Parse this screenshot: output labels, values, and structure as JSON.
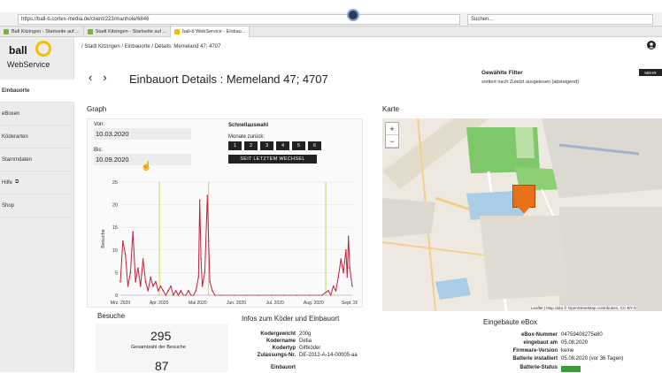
{
  "browser": {
    "url": "https://ball-b.cortex-media.de/client/223/manhole/6846",
    "search_placeholder": "Suchen...",
    "tabs": [
      {
        "label": "Ball Kitzingen - Startseite auf ..."
      },
      {
        "label": "Stadt Kitzingen - Startseite auf ..."
      },
      {
        "label": "ball-b WebService - Einbau..."
      }
    ]
  },
  "brand": {
    "name": "ball",
    "sub": "WebService"
  },
  "sidebar": {
    "items": [
      {
        "label": "Einbauorte"
      },
      {
        "label": "eBoxen"
      },
      {
        "label": "Köderarten"
      },
      {
        "label": "Stammdaten"
      },
      {
        "label": "Hilfe"
      },
      {
        "label": "Shop"
      }
    ]
  },
  "header": {
    "breadcrumb": "/ Stadt Kitzingen / Einbauorte / Details: Memeland 47; 4707",
    "title": "Einbauort Details : Memeland 47; 4707",
    "filter_title": "Gewählte Filter",
    "filter_sub": "sortiert nach Zuletzt ausgelesen (absteigend)",
    "more_label": "MEHR"
  },
  "graph": {
    "section_title": "Graph",
    "von_label": "Von:",
    "von_value": "10.03.2020",
    "bis_label": "Bis:",
    "bis_value": "10.09.2020",
    "quick_title": "Schnellauswahl",
    "quick_sub": "Monate zurück:",
    "quick_buttons": [
      "1",
      "2",
      "3",
      "4",
      "5",
      "6"
    ],
    "reset_label": "SEIT LETZTEM WECHSEL"
  },
  "chart_data": {
    "type": "line",
    "ylabel": "Besuche",
    "ylim": [
      0,
      25
    ],
    "yticks": [
      0,
      5,
      10,
      15,
      20,
      25
    ],
    "xticks": [
      "Mrz. 2020",
      "Apr. 2020",
      "Mai 2020",
      "Jun. 2020",
      "Jul. 2020",
      "Aug. 2020",
      "Sept. 2020"
    ],
    "x_range_days": 184,
    "series": [
      {
        "color": "#c0203a",
        "points": [
          [
            0,
            3
          ],
          [
            2,
            12
          ],
          [
            4,
            9
          ],
          [
            6,
            2
          ],
          [
            8,
            5
          ],
          [
            10,
            14
          ],
          [
            12,
            3
          ],
          [
            14,
            6
          ],
          [
            16,
            2
          ],
          [
            18,
            8
          ],
          [
            20,
            3
          ],
          [
            22,
            1
          ],
          [
            24,
            4
          ],
          [
            26,
            2
          ],
          [
            28,
            3
          ],
          [
            30,
            1
          ],
          [
            32,
            2
          ],
          [
            34,
            1
          ],
          [
            36,
            0
          ],
          [
            38,
            1
          ],
          [
            40,
            2
          ],
          [
            42,
            0
          ],
          [
            44,
            1
          ],
          [
            46,
            0
          ],
          [
            48,
            1
          ],
          [
            50,
            0
          ],
          [
            52,
            0
          ],
          [
            54,
            1
          ],
          [
            56,
            0
          ],
          [
            58,
            0
          ],
          [
            60,
            1
          ],
          [
            62,
            4
          ],
          [
            63,
            21
          ],
          [
            64,
            8
          ],
          [
            65,
            2
          ],
          [
            67,
            5
          ],
          [
            69,
            22
          ],
          [
            70,
            12
          ],
          [
            71,
            3
          ],
          [
            73,
            1
          ],
          [
            75,
            0
          ],
          [
            80,
            0
          ],
          [
            90,
            0
          ],
          [
            100,
            0
          ],
          [
            110,
            0
          ],
          [
            120,
            0
          ],
          [
            130,
            0
          ],
          [
            140,
            0
          ],
          [
            150,
            0
          ],
          [
            160,
            0
          ],
          [
            165,
            1
          ],
          [
            167,
            0
          ],
          [
            169,
            2
          ],
          [
            171,
            1
          ],
          [
            173,
            4
          ],
          [
            175,
            8
          ],
          [
            177,
            5
          ],
          [
            179,
            10
          ],
          [
            180,
            4
          ],
          [
            181,
            13
          ],
          [
            182,
            6
          ],
          [
            184,
            2
          ]
        ]
      }
    ],
    "markers": {
      "color": "#c8d46a",
      "x_days": [
        31,
        70,
        163
      ]
    }
  },
  "map": {
    "section_title": "Karte",
    "zoom_in": "+",
    "zoom_out": "−",
    "attribution": "Leaflet | Map data © OpenStreetMap contributors, CC-BY-S"
  },
  "besuche": {
    "title": "Besuche",
    "total_value": "295",
    "total_label": "Gesamtzahl der Besuche",
    "second_value": "87"
  },
  "info": {
    "title": "Infos zum Köder und Einbauort",
    "rows": [
      {
        "k": "Kodergewicht",
        "v": "200g"
      },
      {
        "k": "Kodername",
        "v": "Detia"
      },
      {
        "k": "Kodertyp",
        "v": "Giftköder"
      },
      {
        "k": "Zulassungs-Nr.",
        "v": "DE-2012-A-14-00005-aa"
      },
      {
        "k": "Einbauort",
        "v": ""
      }
    ]
  },
  "ebox": {
    "title": "Eingebaute eBox",
    "rows": [
      {
        "k": "eBox-Nummer",
        "v": "04759408275e80"
      },
      {
        "k": "eingebaut am",
        "v": "05.08.2020"
      },
      {
        "k": "Firmware-Version",
        "v": "keine"
      },
      {
        "k": "Batterie installiert",
        "v": "05.08.2020 (vor 36 Tagen)"
      },
      {
        "k": "Batterie-Status",
        "v": ""
      }
    ]
  }
}
